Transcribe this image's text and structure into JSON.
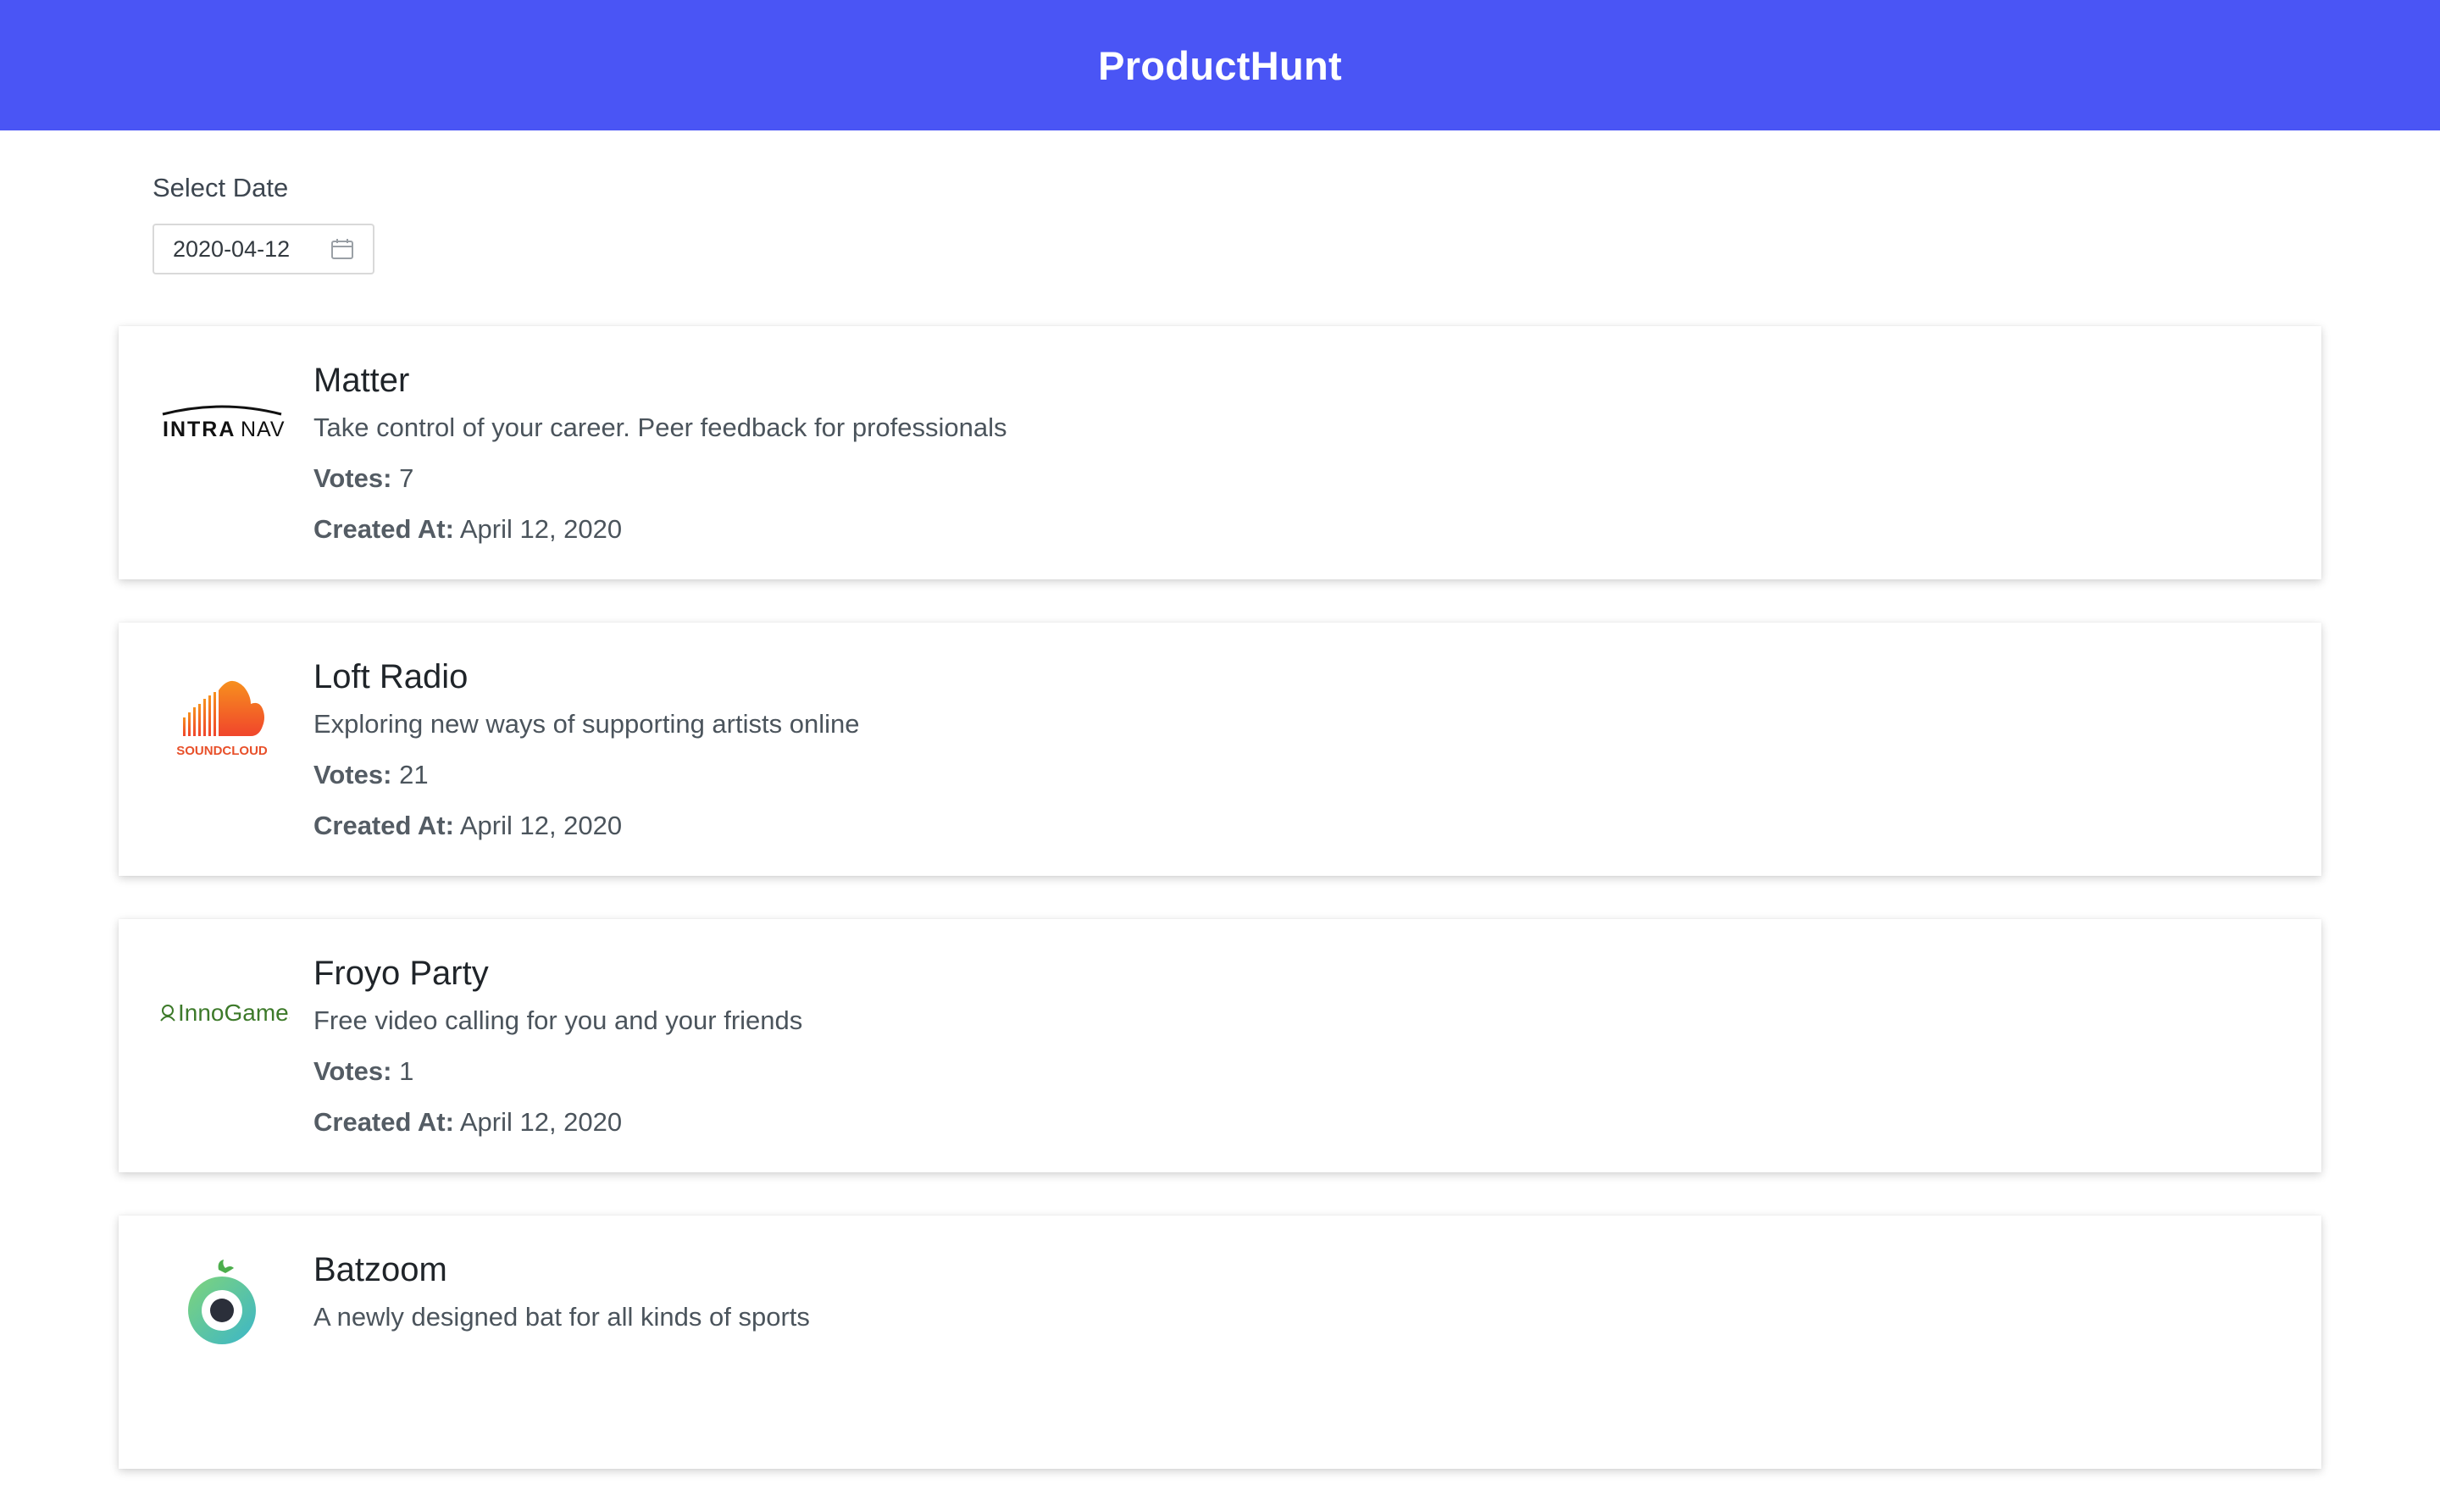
{
  "header": {
    "title": "ProductHunt"
  },
  "date_picker": {
    "label": "Select Date",
    "value": "2020-04-12",
    "icon": "calendar-icon"
  },
  "labels": {
    "votes": "Votes:",
    "created_at": "Created At:"
  },
  "products": [
    {
      "name": "Matter",
      "description": "Take control of your career. Peer feedback for professionals",
      "votes": "7",
      "created_at": "April 12, 2020",
      "logo": "intranav-logo",
      "logo_text_bold": "INTRA",
      "logo_text_light": "NAV"
    },
    {
      "name": "Loft Radio",
      "description": "Exploring new ways of supporting artists online",
      "votes": "21",
      "created_at": "April 12, 2020",
      "logo": "soundcloud-logo",
      "logo_text": "SOUNDCLOUD"
    },
    {
      "name": "Froyo Party",
      "description": "Free video calling for you and your friends",
      "votes": "1",
      "created_at": "April 12, 2020",
      "logo": "innogames-logo",
      "logo_text": "InnoGames"
    },
    {
      "name": "Batzoom",
      "description": "A newly designed bat for all kinds of sports",
      "logo": "batzoom-logo"
    }
  ],
  "colors": {
    "header_bg": "#4a55f5",
    "soundcloud_orange": "#f26b1d",
    "innogames_green": "#3d7a2a"
  }
}
